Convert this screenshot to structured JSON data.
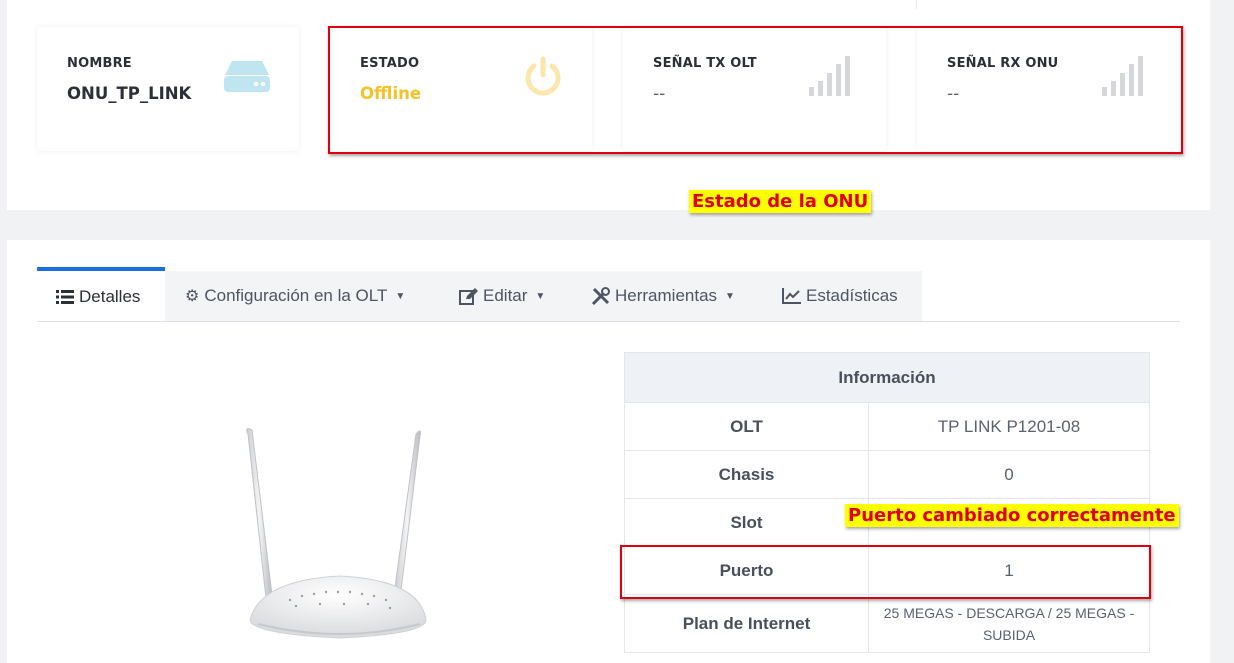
{
  "cards": {
    "nombre": {
      "label": "NOMBRE",
      "value": "ONU_TP_LINK",
      "icon": "server-icon"
    },
    "estado": {
      "label": "ESTADO",
      "value": "Offline",
      "icon": "power-icon",
      "color": "#f6c028"
    },
    "tx": {
      "label": "SEÑAL TX OLT",
      "value": "--",
      "icon": "signal-icon"
    },
    "rx": {
      "label": "SEÑAL RX ONU",
      "value": "--",
      "icon": "signal-icon"
    }
  },
  "annotations": {
    "estado": "Estado de la ONU",
    "puerto": "Puerto cambiado correctamente"
  },
  "tabs": [
    {
      "label": "Detalles",
      "icon": "list-icon",
      "active": true
    },
    {
      "label": "Configuración en la OLT",
      "icon": "gear-icon",
      "dropdown": true
    },
    {
      "label": "Editar",
      "icon": "edit-icon",
      "dropdown": true
    },
    {
      "label": "Herramientas",
      "icon": "tools-icon",
      "dropdown": true
    },
    {
      "label": "Estadísticas",
      "icon": "chart-icon"
    }
  ],
  "info_table": {
    "header": "Información",
    "rows": [
      {
        "key": "OLT",
        "value": "TP LINK P1201-08"
      },
      {
        "key": "Chasis",
        "value": "0"
      },
      {
        "key": "Slot",
        "value": ""
      },
      {
        "key": "Puerto",
        "value": "1"
      },
      {
        "key": "Plan de Internet",
        "value": "25 MEGAS - DESCARGA / 25 MEGAS - SUBIDA"
      }
    ]
  },
  "colors": {
    "accent": "#1c6fde",
    "annotation_red": "#e0000d",
    "annotation_bg": "#ffff00",
    "offline": "#f6c028"
  }
}
